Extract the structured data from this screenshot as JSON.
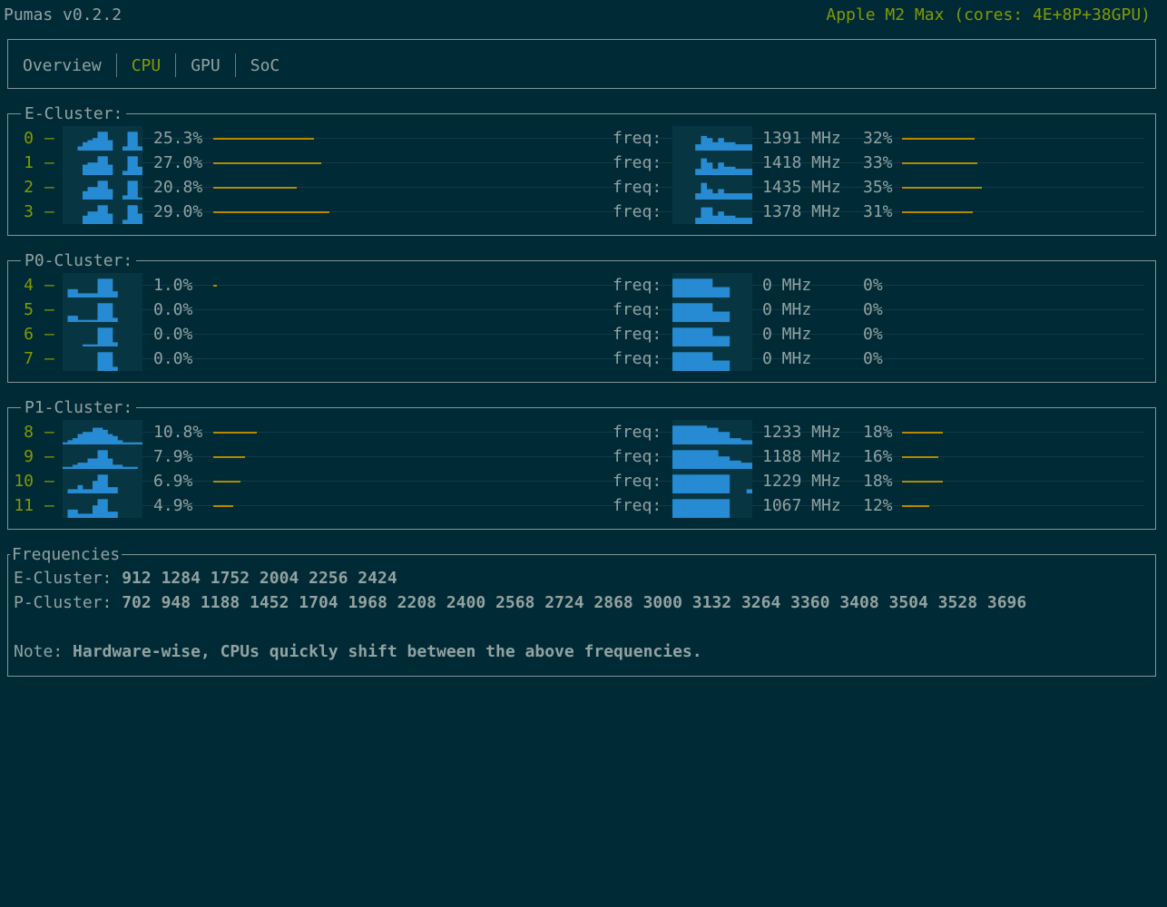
{
  "app_title": "Pumas v0.2.2",
  "device": "Apple M2 Max (cores: 4E+8P+38GPU)",
  "tabs": [
    {
      "label": "Overview",
      "active": false
    },
    {
      "label": "CPU",
      "active": true
    },
    {
      "label": "GPU",
      "active": false
    },
    {
      "label": "SoC",
      "active": false
    }
  ],
  "colors": {
    "background": "#002b36",
    "accent": "#859900",
    "bar": "#b58900",
    "spark": "#268bd2"
  },
  "freq_label": "freq:",
  "clusters": [
    {
      "name": "E-Cluster:",
      "cores": [
        {
          "id": "0",
          "usage": "25.3%",
          "usage_value": 25.3,
          "mhz": "1391 MHz",
          "freq_pct": "32%",
          "freq_value": 32,
          "usage_hist": [
            0,
            0,
            0,
            0.2,
            0.4,
            0.5,
            0.6,
            0.9,
            0.9,
            0.5,
            0,
            0,
            0.2,
            0.9,
            0.9,
            0.2
          ],
          "freq_hist": [
            0,
            0,
            0,
            0,
            0.3,
            0.7,
            0.6,
            0.4,
            0.6,
            0.4,
            0.4,
            0.3,
            0.3,
            0.3
          ]
        },
        {
          "id": "1",
          "usage": "27.0%",
          "usage_value": 27.0,
          "mhz": "1418 MHz",
          "freq_pct": "33%",
          "freq_value": 33,
          "usage_hist": [
            0,
            0,
            0,
            0,
            0.5,
            0.6,
            0.6,
            0.9,
            0.9,
            0.5,
            0,
            0,
            0.2,
            0.9,
            0.9,
            0.4
          ],
          "freq_hist": [
            0,
            0,
            0,
            0,
            0.3,
            0.8,
            0.6,
            0.3,
            0.6,
            0.4,
            0.4,
            0.3,
            0.3,
            0.3
          ]
        },
        {
          "id": "2",
          "usage": "20.8%",
          "usage_value": 20.8,
          "mhz": "1435 MHz",
          "freq_pct": "35%",
          "freq_value": 35,
          "usage_hist": [
            0,
            0,
            0,
            0,
            0.4,
            0.6,
            0.6,
            0.9,
            0.9,
            0.5,
            0,
            0,
            0.2,
            0.9,
            0.9,
            0.1
          ],
          "freq_hist": [
            0,
            0,
            0,
            0,
            0.3,
            0.8,
            0.5,
            0.3,
            0.5,
            0.3,
            0.3,
            0.3,
            0.3,
            0.3
          ]
        },
        {
          "id": "3",
          "usage": "29.0%",
          "usage_value": 29.0,
          "mhz": "1378 MHz",
          "freq_pct": "31%",
          "freq_value": 31,
          "usage_hist": [
            0,
            0,
            0,
            0,
            0.4,
            0.6,
            0.6,
            0.9,
            0.9,
            0.5,
            0,
            0,
            0.2,
            0.9,
            0.9,
            0.5
          ],
          "freq_hist": [
            0,
            0,
            0,
            0,
            0.3,
            0.8,
            0.8,
            0.4,
            0.6,
            0.4,
            0.4,
            0.3,
            0.3,
            0.3
          ]
        }
      ]
    },
    {
      "name": "P0-Cluster:",
      "cores": [
        {
          "id": "4",
          "usage": "1.0%",
          "usage_value": 1.0,
          "mhz": "0 MHz",
          "freq_pct": "0%",
          "freq_value": 0,
          "usage_hist": [
            0,
            0.4,
            0.4,
            0.2,
            0.2,
            0.2,
            0.2,
            0.9,
            0.9,
            0.9,
            0.3,
            0,
            0,
            0,
            0,
            0
          ],
          "freq_hist": [
            0.9,
            0.9,
            0.9,
            0.9,
            0.9,
            0.9,
            0.9,
            0.5,
            0.5,
            0.5,
            0,
            0,
            0,
            0
          ]
        },
        {
          "id": "5",
          "usage": "0.0%",
          "usage_value": 0.0,
          "mhz": "0 MHz",
          "freq_pct": "0%",
          "freq_value": 0,
          "usage_hist": [
            0,
            0.3,
            0.3,
            0.1,
            0.1,
            0.1,
            0.1,
            0.9,
            0.9,
            0.9,
            0.2,
            0,
            0,
            0,
            0,
            0
          ],
          "freq_hist": [
            0.9,
            0.9,
            0.9,
            0.9,
            0.9,
            0.9,
            0.9,
            0.5,
            0.5,
            0.5,
            0,
            0,
            0,
            0
          ]
        },
        {
          "id": "6",
          "usage": "0.0%",
          "usage_value": 0.0,
          "mhz": "0 MHz",
          "freq_pct": "0%",
          "freq_value": 0,
          "usage_hist": [
            0,
            0,
            0,
            0,
            0.1,
            0.1,
            0.1,
            0.9,
            0.9,
            0.9,
            0.2,
            0,
            0,
            0,
            0,
            0
          ],
          "freq_hist": [
            0.9,
            0.9,
            0.9,
            0.9,
            0.9,
            0.9,
            0.9,
            0.5,
            0.5,
            0.5,
            0,
            0,
            0,
            0
          ]
        },
        {
          "id": "7",
          "usage": "0.0%",
          "usage_value": 0.0,
          "mhz": "0 MHz",
          "freq_pct": "0%",
          "freq_value": 0,
          "usage_hist": [
            0,
            0,
            0,
            0,
            0,
            0,
            0,
            0.9,
            0.9,
            0.9,
            0.2,
            0,
            0,
            0,
            0,
            0
          ],
          "freq_hist": [
            0.9,
            0.9,
            0.9,
            0.9,
            0.9,
            0.9,
            0.9,
            0.5,
            0.5,
            0.5,
            0,
            0,
            0,
            0
          ]
        }
      ]
    },
    {
      "name": "P1-Cluster:",
      "cores": [
        {
          "id": "8",
          "usage": "10.8%",
          "usage_value": 10.8,
          "mhz": "1233 MHz",
          "freq_pct": "18%",
          "freq_value": 18,
          "usage_hist": [
            0.1,
            0.2,
            0.3,
            0.5,
            0.6,
            0.6,
            0.8,
            0.8,
            0.7,
            0.5,
            0.4,
            0.2,
            0.1,
            0.1,
            0.1,
            0.1
          ],
          "freq_hist": [
            0.9,
            0.9,
            0.9,
            0.9,
            0.9,
            0.9,
            0.8,
            0.8,
            0.6,
            0.6,
            0.3,
            0.3,
            0.2,
            0.2
          ]
        },
        {
          "id": "9",
          "usage": "7.9%",
          "usage_value": 7.9,
          "mhz": "1188 MHz",
          "freq_pct": "16%",
          "freq_value": 16,
          "usage_hist": [
            0.1,
            0.1,
            0.2,
            0.3,
            0.3,
            0.5,
            0.5,
            0.9,
            0.9,
            0.5,
            0.2,
            0.2,
            0.1,
            0.1,
            0.1,
            0
          ],
          "freq_hist": [
            0.9,
            0.9,
            0.9,
            0.9,
            0.9,
            0.9,
            0.9,
            0.9,
            0.6,
            0.6,
            0.4,
            0.4,
            0.3,
            0.3
          ]
        },
        {
          "id": "10",
          "usage": "6.9%",
          "usage_value": 6.9,
          "mhz": "1229 MHz",
          "freq_pct": "18%",
          "freq_value": 18,
          "usage_hist": [
            0,
            0.2,
            0.2,
            0.4,
            0.2,
            0.2,
            0.6,
            0.9,
            0.9,
            0.3,
            0.3,
            0,
            0,
            0,
            0,
            0
          ],
          "freq_hist": [
            0.9,
            0.9,
            0.9,
            0.9,
            0.9,
            0.9,
            0.9,
            0.9,
            0.9,
            0.9,
            0,
            0,
            0,
            0.2
          ]
        },
        {
          "id": "11",
          "usage": "4.9%",
          "usage_value": 4.9,
          "mhz": "1067 MHz",
          "freq_pct": "12%",
          "freq_value": 12,
          "usage_hist": [
            0,
            0.4,
            0.4,
            0.2,
            0.2,
            0.2,
            0.6,
            0.9,
            0.9,
            0.3,
            0.3,
            0,
            0,
            0,
            0,
            0
          ],
          "freq_hist": [
            0.9,
            0.9,
            0.9,
            0.9,
            0.9,
            0.9,
            0.9,
            0.9,
            0.9,
            0.9,
            0,
            0,
            0,
            0
          ]
        }
      ]
    }
  ],
  "frequencies": {
    "title": "Frequencies",
    "e_label": "E-Cluster:",
    "e_values": "912 1284 1752 2004 2256 2424",
    "p_label": "P-Cluster:",
    "p_values": "702  948 1188 1452 1704 1968 2208 2400 2568 2724 2868 3000 3132 3264 3360 3408 3504 3528 3696",
    "note_label": "Note:",
    "note_text": "Hardware-wise, CPUs quickly shift between the above frequencies."
  }
}
